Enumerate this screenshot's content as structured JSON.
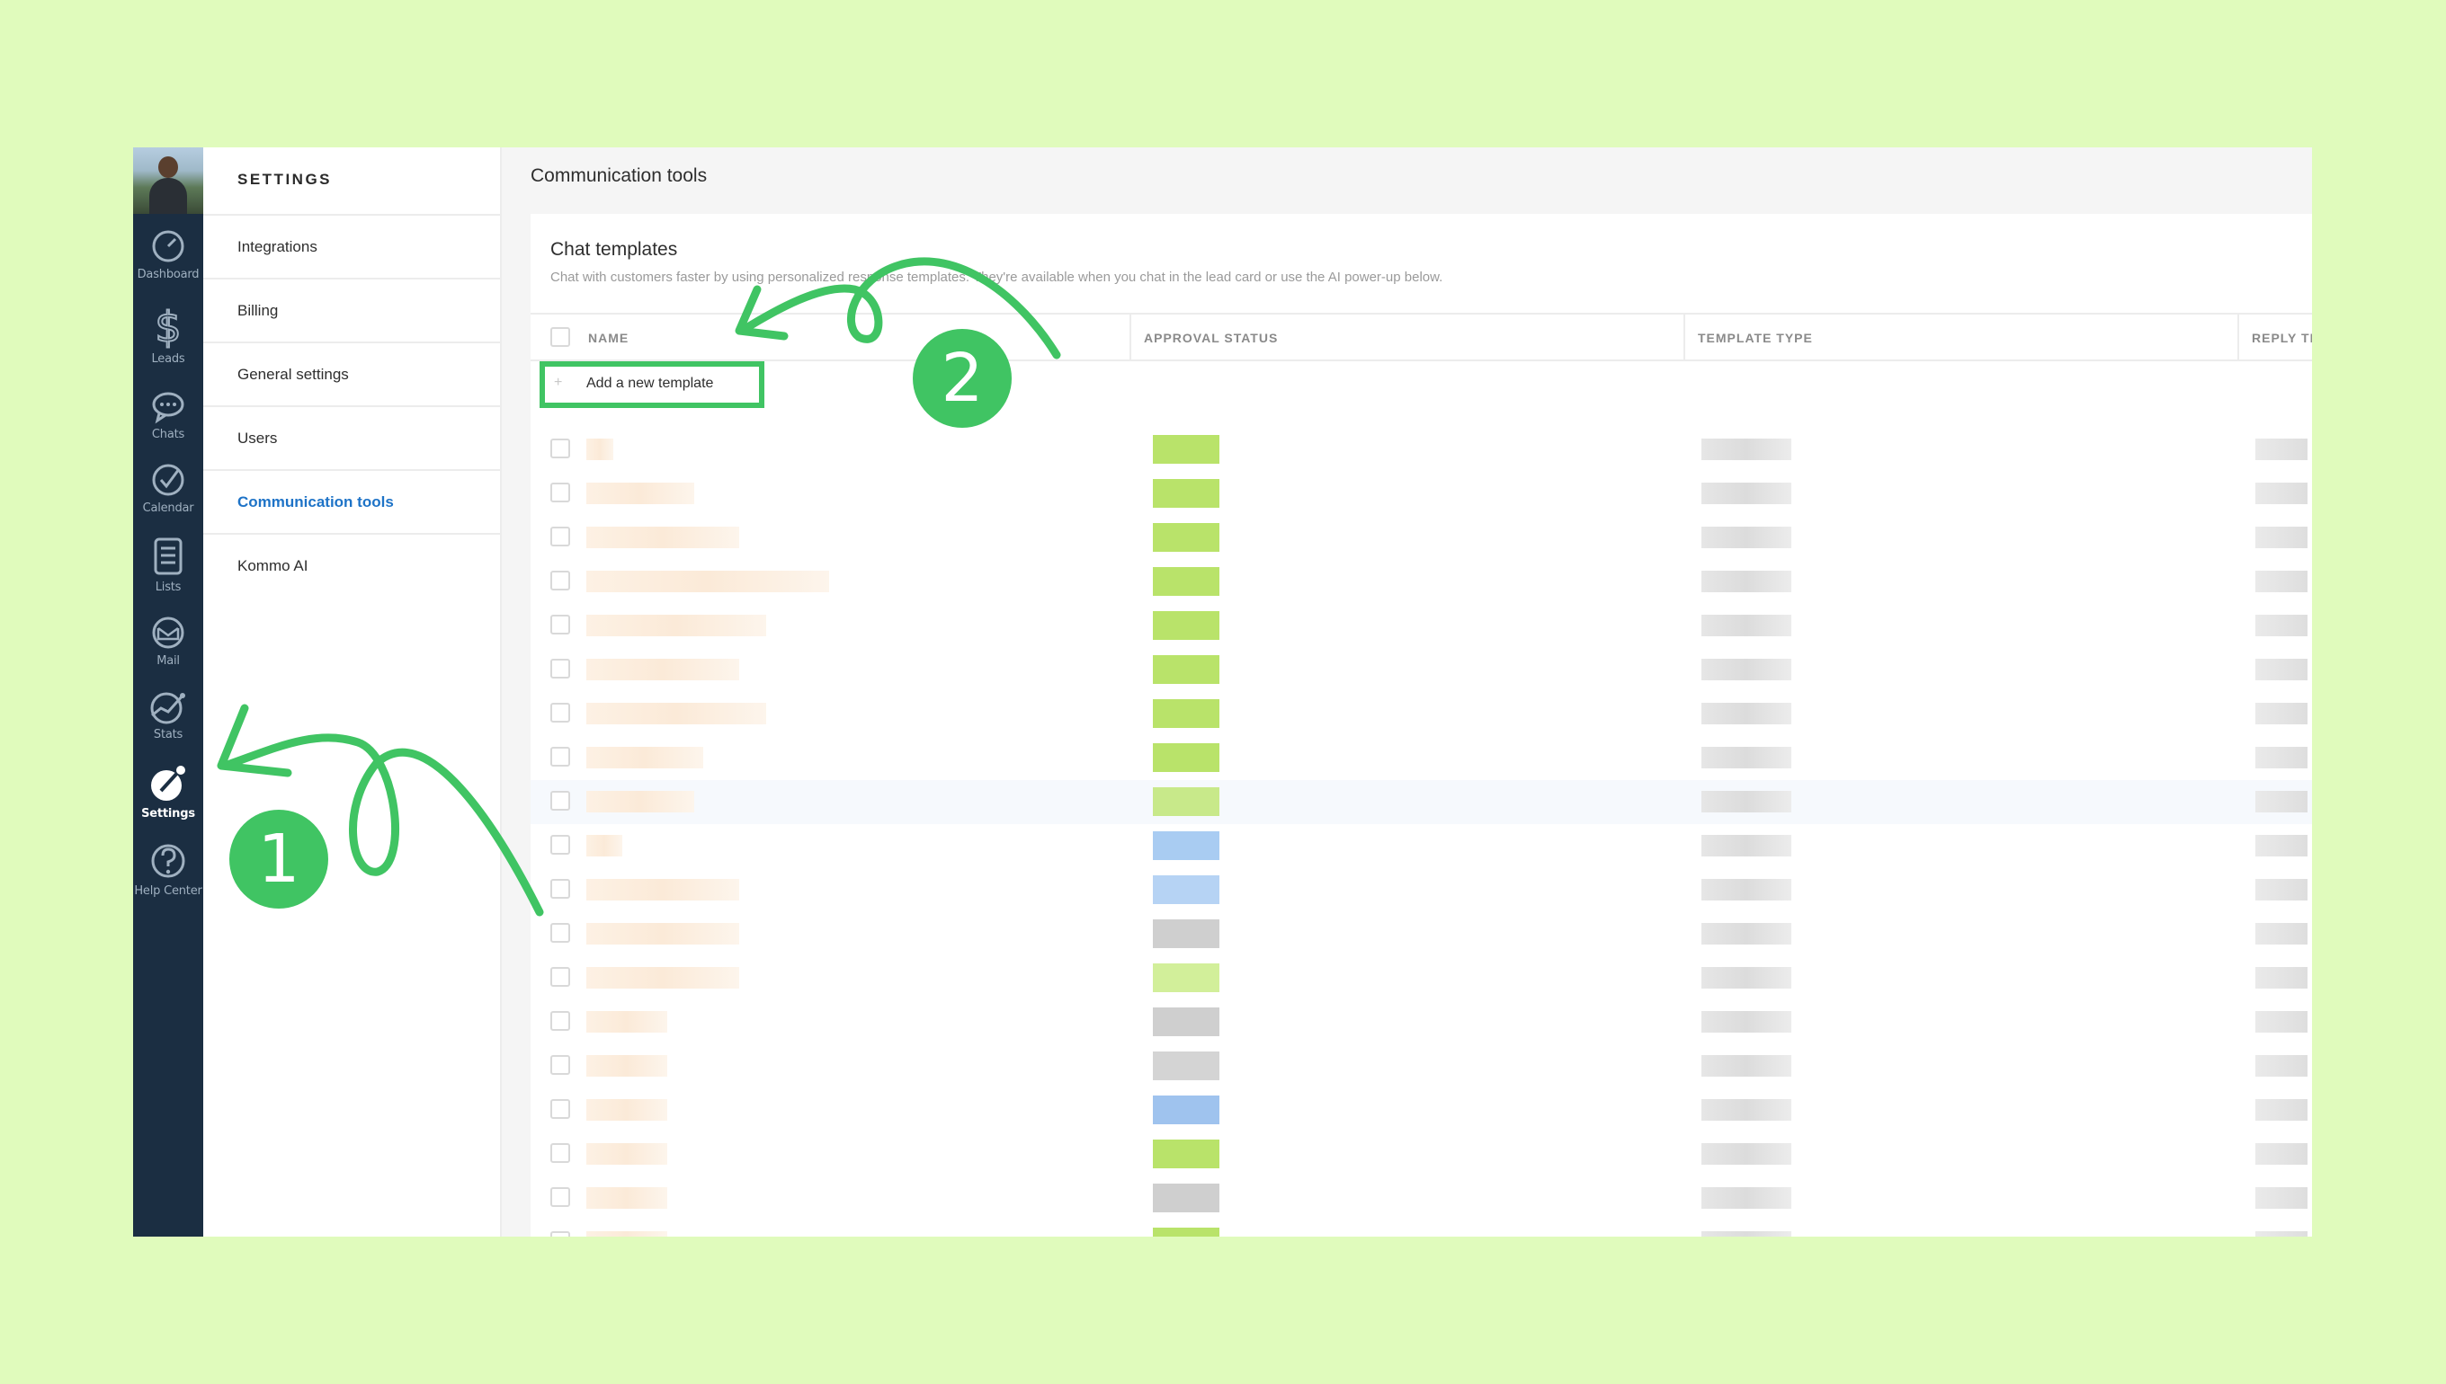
{
  "nav": {
    "items": [
      {
        "label": "Dashboard",
        "icon": "dashboard-icon"
      },
      {
        "label": "Leads",
        "icon": "dollar-icon"
      },
      {
        "label": "Chats",
        "icon": "chat-bubble-icon"
      },
      {
        "label": "Calendar",
        "icon": "check-circle-icon"
      },
      {
        "label": "Lists",
        "icon": "list-icon"
      },
      {
        "label": "Mail",
        "icon": "mail-icon"
      },
      {
        "label": "Stats",
        "icon": "stats-icon"
      },
      {
        "label": "Settings",
        "icon": "settings-icon"
      },
      {
        "label": "Help Center",
        "icon": "help-icon"
      }
    ]
  },
  "settings": {
    "title": "SETTINGS",
    "items": [
      {
        "label": "Integrations"
      },
      {
        "label": "Billing"
      },
      {
        "label": "General settings"
      },
      {
        "label": "Users"
      },
      {
        "label": "Communication tools"
      },
      {
        "label": "Kommo AI"
      }
    ]
  },
  "main": {
    "page_title": "Communication tools",
    "card_title": "Chat templates",
    "card_desc": "Chat with customers faster by using personalized response templates. They're available when you chat in the lead card or use the AI power-up below.",
    "columns": {
      "name": "NAME",
      "approval_status": "APPROVAL STATUS",
      "template_type": "TEMPLATE TYPE",
      "reply_time": "REPLY TI"
    },
    "add_template_label": "Add a new template"
  },
  "annotations": {
    "step1": "1",
    "step2": "2",
    "color": "#40c463"
  },
  "colors": {
    "nav_bg": "#1b2e42",
    "accent_link": "#1e73c7",
    "page_bg": "#e0fbbc"
  }
}
